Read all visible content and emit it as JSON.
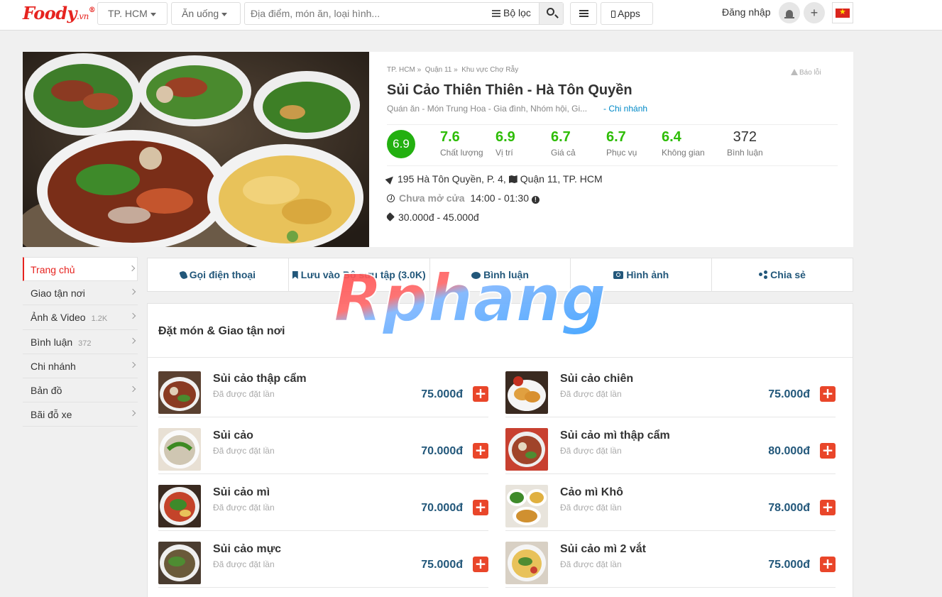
{
  "header": {
    "logo_text": "Foody",
    "logo_sub": ".vn",
    "logo_reg": "®",
    "city_label": "TP. HCM",
    "category_label": "Ăn uống",
    "search_placeholder": "Địa điểm, món ăn, loại hình...",
    "filter_label": "Bộ lọc",
    "apps_label": "Apps",
    "login_label": "Đăng nhập",
    "add_label": "+"
  },
  "restaurant": {
    "breadcrumb": [
      "TP. HCM",
      "Quận 11",
      "Khu vực Chợ Rẫy"
    ],
    "report_label": "Báo lỗi",
    "name": "Sủi Cảo Thiên Thiên - Hà Tôn Quyền",
    "categories": "Quán ăn  -  Món Trung Hoa  - Gia đình, Nhóm hội, Gi...",
    "branch_link": "- Chi nhánh",
    "overall_score": "6.9",
    "scores": [
      {
        "value": "7.6",
        "label": "Chất lượng"
      },
      {
        "value": "6.9",
        "label": "Vị trí"
      },
      {
        "value": "6.7",
        "label": "Giá cả"
      },
      {
        "value": "6.7",
        "label": "Phục vụ"
      },
      {
        "value": "6.4",
        "label": "Không gian"
      }
    ],
    "review_count": "372",
    "review_label": "Bình luận",
    "address": "195 Hà Tôn Quyền, P. 4,",
    "district": "Quận 11, TP. HCM",
    "status": "Chưa mở cửa",
    "hours": "14:00 - 01:30",
    "price_range": "30.000đ - 45.000đ"
  },
  "side_menu": [
    {
      "label": "Trang chủ",
      "count": ""
    },
    {
      "label": "Giao tận nơi",
      "count": ""
    },
    {
      "label": "Ảnh & Video",
      "count": "1.2K"
    },
    {
      "label": "Bình luận",
      "count": "372"
    },
    {
      "label": "Chi nhánh",
      "count": ""
    },
    {
      "label": "Bản đồ",
      "count": ""
    },
    {
      "label": "Bãi đỗ xe",
      "count": ""
    }
  ],
  "actions": [
    "Gọi điện thoại",
    "Lưu vào Bộ sưu tập (3.0K)",
    "Bình luận",
    "Hình ảnh",
    "Chia sẻ"
  ],
  "order": {
    "title": "Đặt món & Giao tận nơi",
    "dishes": [
      {
        "name": "Sủi cảo thập cẩm",
        "sub": "Đã được đặt lần",
        "price": "75.000đ"
      },
      {
        "name": "Sủi cảo chiên",
        "sub": "Đã được đặt lần",
        "price": "75.000đ"
      },
      {
        "name": "Sủi cảo",
        "sub": "Đã được đặt lần",
        "price": "70.000đ"
      },
      {
        "name": "Sủi cảo mì thập cẩm",
        "sub": "Đã được đặt lần",
        "price": "80.000đ"
      },
      {
        "name": "Sủi cảo mì",
        "sub": "Đã được đặt lần",
        "price": "70.000đ"
      },
      {
        "name": "Cảo mì Khô",
        "sub": "Đã được đặt lần",
        "price": "78.000đ"
      },
      {
        "name": "Sủi cảo mực",
        "sub": "Đã được đặt lần",
        "price": "75.000đ"
      },
      {
        "name": "Sủi cảo mì 2 vắt",
        "sub": "Đã được đặt lần",
        "price": "75.000đ"
      }
    ]
  },
  "watermark": "Rphang",
  "colors": {
    "brand": "#e6231f",
    "score_green": "#2ebd06",
    "link_blue": "#22577a",
    "add_red": "#e9462a"
  }
}
